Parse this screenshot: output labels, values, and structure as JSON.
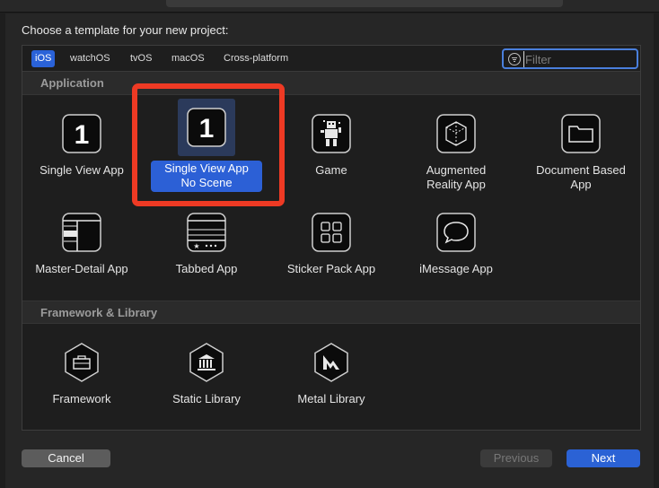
{
  "dialog": {
    "prompt": "Choose a template for your new project:",
    "filter_placeholder": "Filter"
  },
  "platform_tabs": [
    "iOS",
    "watchOS",
    "tvOS",
    "macOS",
    "Cross-platform"
  ],
  "selected_platform": "iOS",
  "sections": {
    "application": {
      "title": "Application",
      "templates": [
        {
          "label": "Single View App",
          "icon": "number-one-icon"
        },
        {
          "label": "Single View App\nNo Scene",
          "icon": "number-one-icon",
          "selected": true
        },
        {
          "label": "Game",
          "icon": "robot-icon"
        },
        {
          "label": "Augmented\nReality App",
          "icon": "ar-cube-icon"
        },
        {
          "label": "Document Based\nApp",
          "icon": "folder-icon"
        },
        {
          "label": "Master-Detail App",
          "icon": "master-detail-icon"
        },
        {
          "label": "Tabbed App",
          "icon": "tab-bar-icon"
        },
        {
          "label": "Sticker Pack App",
          "icon": "grid-icon"
        },
        {
          "label": "iMessage App",
          "icon": "speech-bubble-icon"
        }
      ]
    },
    "framework": {
      "title": "Framework & Library",
      "templates": [
        {
          "label": "Framework",
          "icon": "toolbox-icon"
        },
        {
          "label": "Static Library",
          "icon": "building-columns-icon"
        },
        {
          "label": "Metal Library",
          "icon": "metal-icon"
        }
      ]
    }
  },
  "buttons": {
    "cancel": "Cancel",
    "previous": "Previous",
    "next": "Next"
  },
  "colors": {
    "accent": "#2c60d6",
    "annotation_box": "#ee3a24"
  }
}
